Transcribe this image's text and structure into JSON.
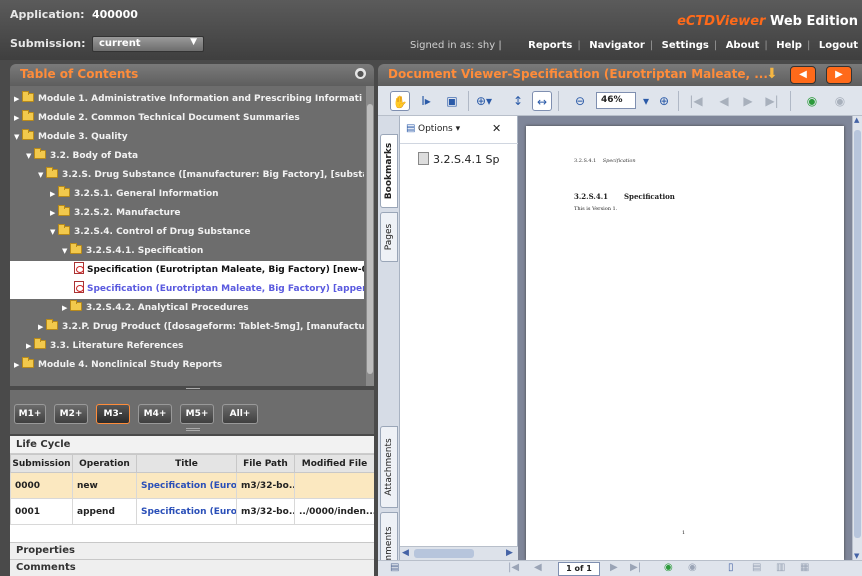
{
  "header": {
    "application_label": "Application:",
    "application_value": "400000",
    "submission_label": "Submission:",
    "submission_value": "current",
    "brand_name": "eCTDViewer",
    "brand_edition": "Web Edition",
    "signed_in": "Signed in as: shy |",
    "nav": [
      "Reports",
      "Navigator",
      "Settings",
      "About",
      "Help",
      "Logout"
    ]
  },
  "toc": {
    "title": "Table of Contents",
    "items": [
      {
        "label": "Module 1. Administrative Information and Prescribing Informati",
        "level": 0,
        "type": "folder",
        "expanded": false
      },
      {
        "label": "Module 2. Common Technical Document Summaries",
        "level": 0,
        "type": "folder",
        "expanded": false
      },
      {
        "label": "Module 3. Quality",
        "level": 0,
        "type": "folder",
        "expanded": true
      },
      {
        "label": "3.2. Body of Data",
        "level": 1,
        "type": "folder",
        "expanded": true
      },
      {
        "label": "3.2.S. Drug Substance ([manufacturer: Big Factory], [substa",
        "level": 2,
        "type": "folder",
        "expanded": true
      },
      {
        "label": "3.2.S.1. General Information",
        "level": 3,
        "type": "folder",
        "expanded": false
      },
      {
        "label": "3.2.S.2. Manufacture",
        "level": 3,
        "type": "folder",
        "expanded": false
      },
      {
        "label": "3.2.S.4. Control of Drug Substance",
        "level": 3,
        "type": "folder",
        "expanded": true
      },
      {
        "label": "3.2.S.4.1. Specification",
        "level": 4,
        "type": "folder",
        "expanded": true
      },
      {
        "label": "Specification (Eurotriptan Maleate, Big Factory) [new-0(",
        "level": 5,
        "type": "doc",
        "state": "selected"
      },
      {
        "label": "Specification (Eurotriptan Maleate, Big Factory) [appen(",
        "level": 5,
        "type": "doc",
        "state": "selected-append"
      },
      {
        "label": "3.2.S.4.2. Analytical Procedures",
        "level": 4,
        "type": "folder",
        "expanded": false
      },
      {
        "label": "3.2.P. Drug Product ([dosageform: Tablet-5mg], [manufactu",
        "level": 2,
        "type": "folder",
        "expanded": false
      },
      {
        "label": "3.3. Literature References",
        "level": 1,
        "type": "folder",
        "expanded": false
      },
      {
        "label": "Module 4. Nonclinical Study Reports",
        "level": 0,
        "type": "folder",
        "expanded": false
      }
    ]
  },
  "modules": [
    "M1+",
    "M2+",
    "M3-",
    "M4+",
    "M5+",
    "All+"
  ],
  "lifecycle": {
    "title": "Life Cycle",
    "columns": [
      "Submission",
      "Operation",
      "Title",
      "File Path",
      "Modified File"
    ],
    "rows": [
      [
        "0000",
        "new",
        "Specification (Euro...",
        "m3/32-bo...",
        ""
      ],
      [
        "0001",
        "append",
        "Specification (Euro...",
        "m3/32-bo...",
        "../0000/inden..."
      ]
    ]
  },
  "properties_label": "Properties",
  "comments_label": "Comments",
  "viewer": {
    "title": "Document Viewer-Specification (Eurotriptan Maleate, ...",
    "zoom": "46%",
    "side_tabs": [
      "Bookmarks",
      "Pages",
      "Attachments",
      "Comments"
    ],
    "options_label": "Options",
    "bookmark_item": "3.2.S.4.1 Sp",
    "page_indicator": "1 of 1",
    "page": {
      "header_num": "3.2.S.4.1",
      "header_title": "Specification",
      "section_num": "3.2.S.4.1",
      "section_title": "Specification",
      "body": "This is Version 1.",
      "footer": "1"
    }
  },
  "colors": {
    "accent": "#ff8c3a",
    "panel": "#6d6d6d",
    "link": "#2a4fb8"
  }
}
